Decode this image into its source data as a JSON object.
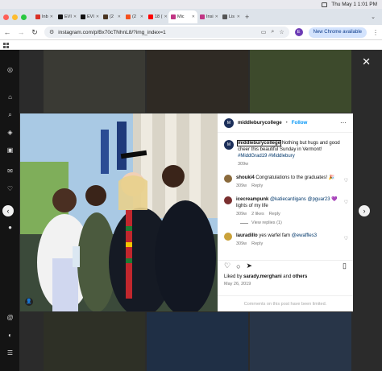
{
  "menubar": {
    "datetime": "Thu May 1  1:01 PM"
  },
  "tabs": [
    {
      "label": "Inb",
      "color": "#d93025"
    },
    {
      "label": "EVI",
      "color": "#111111"
    },
    {
      "label": "EVI",
      "color": "#111111"
    },
    {
      "label": "(2",
      "color": "#4a3520"
    },
    {
      "label": "(2",
      "color": "#f4511e"
    },
    {
      "label": "18 (",
      "color": "#ff0000"
    },
    {
      "label": "Mic",
      "color": "#c13584",
      "active": true
    },
    {
      "label": "Insi",
      "color": "#c13584"
    },
    {
      "label": "Lis",
      "color": "#555555"
    }
  ],
  "browser": {
    "url": "instagram.com/p/Bx70cTNhnL8/?img_index=1",
    "profile_initial": "E",
    "chrome_button": "New Chrome available"
  },
  "post": {
    "username": "middleburycollege",
    "follow_label": "Follow",
    "separator": "•",
    "caption_user": "middleburycollege",
    "caption_text": "Nothing but hugs and good cheer this beautiful Sunday in Vermont!",
    "caption_tags": "#MiddGrad19 #Middlebury",
    "caption_time": "309w",
    "comments": [
      {
        "user": "shouki4",
        "text": "Congratulations to the graduates! 🎉",
        "time": "309w",
        "likes": "",
        "reply": "Reply",
        "avatar_color": "#8a6a3c"
      },
      {
        "user": "icecreampunk",
        "mentions": "@katiecardigans @pguar23",
        "text": "💜 lights of my life",
        "time": "309w",
        "likes": "2 likes",
        "reply": "Reply",
        "avatar_color": "#7a2f2f",
        "view_replies": "View replies (1)"
      },
      {
        "user": "lauradillo",
        "text": "yes warfel fam",
        "mentions": "@ewaffles3",
        "time": "309w",
        "likes": "",
        "reply": "Reply",
        "avatar_color": "#caa23a"
      }
    ],
    "liked_by_prefix": "Liked by",
    "liked_by_user": "sarady.merghani",
    "liked_by_and": "and",
    "liked_by_others": "others",
    "date": "May 26, 2019",
    "limited_notice": "Comments on this post have been limited."
  }
}
